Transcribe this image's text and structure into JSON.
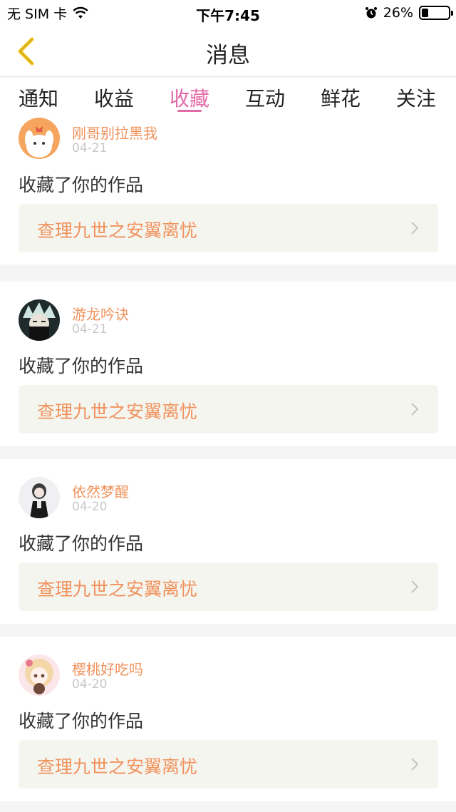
{
  "status_bar": {
    "carrier": "无 SIM 卡",
    "time": "下午7:45",
    "battery_percent": "26%",
    "battery_level": 0.26
  },
  "nav": {
    "title": "消息"
  },
  "tabs": [
    {
      "label": "通知",
      "active": false
    },
    {
      "label": "收益",
      "active": false
    },
    {
      "label": "收藏",
      "active": true
    },
    {
      "label": "互动",
      "active": false
    },
    {
      "label": "鲜花",
      "active": false
    },
    {
      "label": "关注",
      "active": false
    }
  ],
  "items": [
    {
      "username": "刚哥别拉黑我",
      "date": "04-21",
      "action": "收藏了你的作品",
      "work": "查理九世之安翼离忧"
    },
    {
      "username": "游龙吟诀",
      "date": "04-21",
      "action": "收藏了你的作品",
      "work": "查理九世之安翼离忧"
    },
    {
      "username": "依然梦醒",
      "date": "04-20",
      "action": "收藏了你的作品",
      "work": "查理九世之安翼离忧"
    },
    {
      "username": "樱桃好吃吗",
      "date": "04-20",
      "action": "收藏了你的作品",
      "work": "查理九世之安翼离忧"
    }
  ],
  "colors": {
    "accent": "#e26aa6",
    "orange": "#f0925d",
    "back_arrow": "#f0c51a"
  }
}
